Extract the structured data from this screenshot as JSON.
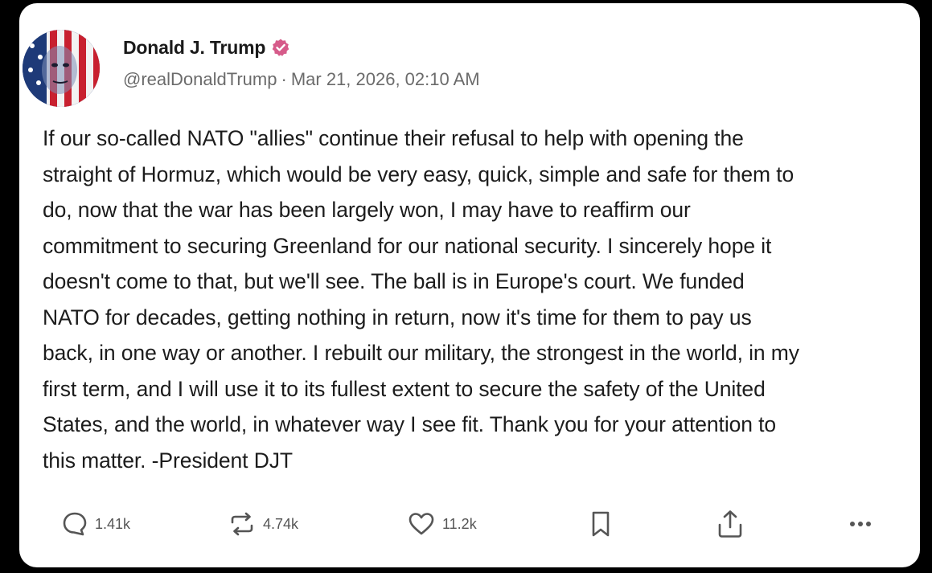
{
  "author": {
    "display_name": "Donald J. Trump",
    "handle": "@realDonaldTrump",
    "separator": "·",
    "timestamp": "Mar 21, 2026, 02:10 AM",
    "verified_badge_color": "#d65b8a"
  },
  "post": {
    "lines": [
      "If our so-called NATO \"allies\" continue their refusal to help with opening the",
      "straight of Hormuz, which would be very easy, quick, simple and safe for them to",
      "do, now that the war has been largely won, I may have to reaffirm our",
      "commitment to securing Greenland for our national security. I sincerely hope it",
      "doesn't come to that, but we'll see. The ball is in Europe's court. We funded",
      "NATO for decades, getting nothing in return, now it's time for them to pay us",
      "back, in one way or another. I rebuilt our military, the strongest in the world, in my",
      "first term, and I will use it to its fullest extent to secure the safety of the United",
      "States, and the world, in whatever way I see fit. Thank you for your attention to",
      "this matter. -President DJT"
    ]
  },
  "actions": {
    "replies": {
      "icon": "reply-icon",
      "count": "1.41k"
    },
    "reposts": {
      "icon": "repost-icon",
      "count": "4.74k"
    },
    "likes": {
      "icon": "heart-icon",
      "count": "11.2k"
    },
    "bookmark": {
      "icon": "bookmark-icon"
    },
    "share": {
      "icon": "share-icon"
    },
    "more": {
      "icon": "more-icon"
    }
  }
}
